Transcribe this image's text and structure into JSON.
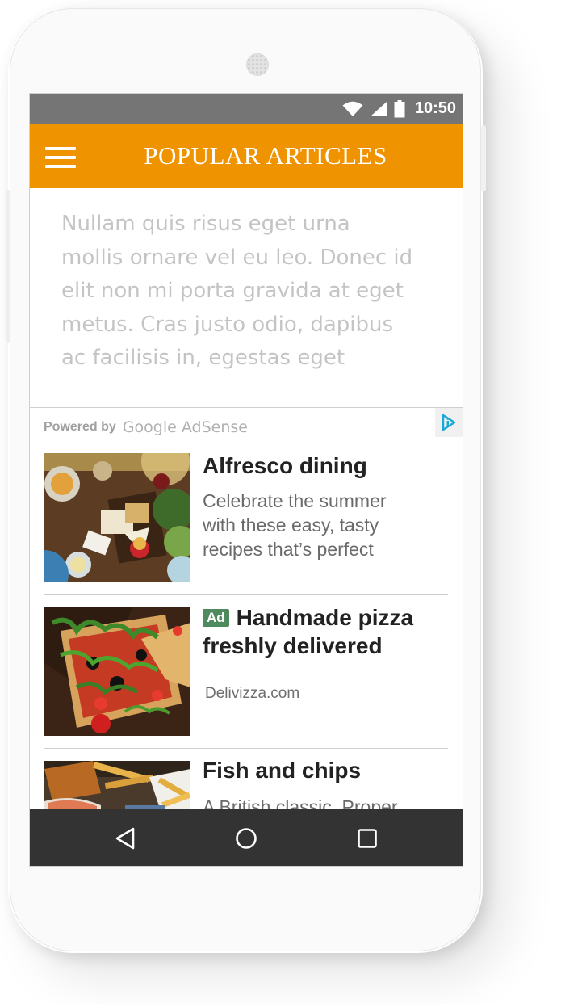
{
  "status_bar": {
    "time": "10:50",
    "icons": [
      "wifi-icon",
      "signal-icon",
      "battery-icon"
    ]
  },
  "app_bar": {
    "title": "POPULAR ARTICLES",
    "menu_icon": "hamburger-menu-icon",
    "color": "#f09300"
  },
  "intro": {
    "text": "Nullam quis risus eget urna\nmollis ornare vel eu leo. Donec id\nelit non mi porta gravida at eget\nmetus. Cras justo odio, dapibus\nac facilisis in, egestas eget"
  },
  "ad_unit": {
    "powered_label": "Powered by",
    "brand": "Google AdSense",
    "adchoices_icon": "adchoices-icon"
  },
  "items": [
    {
      "title": "Alfresco dining",
      "description": "Celebrate the summer\nwith these easy, tasty\nrecipes that’s perfect",
      "image": "alfresco-dining-photo"
    },
    {
      "badge": "Ad",
      "title": "Handmade pizza freshly delivered",
      "source": "Delivizza.com",
      "image": "pizza-photo",
      "badge_color": "#4f8a5e"
    },
    {
      "title": "Fish and chips",
      "description": "A British classic. Proper",
      "image": "fish-and-chips-photo"
    }
  ],
  "nav_bar": {
    "icons": [
      "back-icon",
      "home-icon",
      "recents-icon"
    ]
  }
}
